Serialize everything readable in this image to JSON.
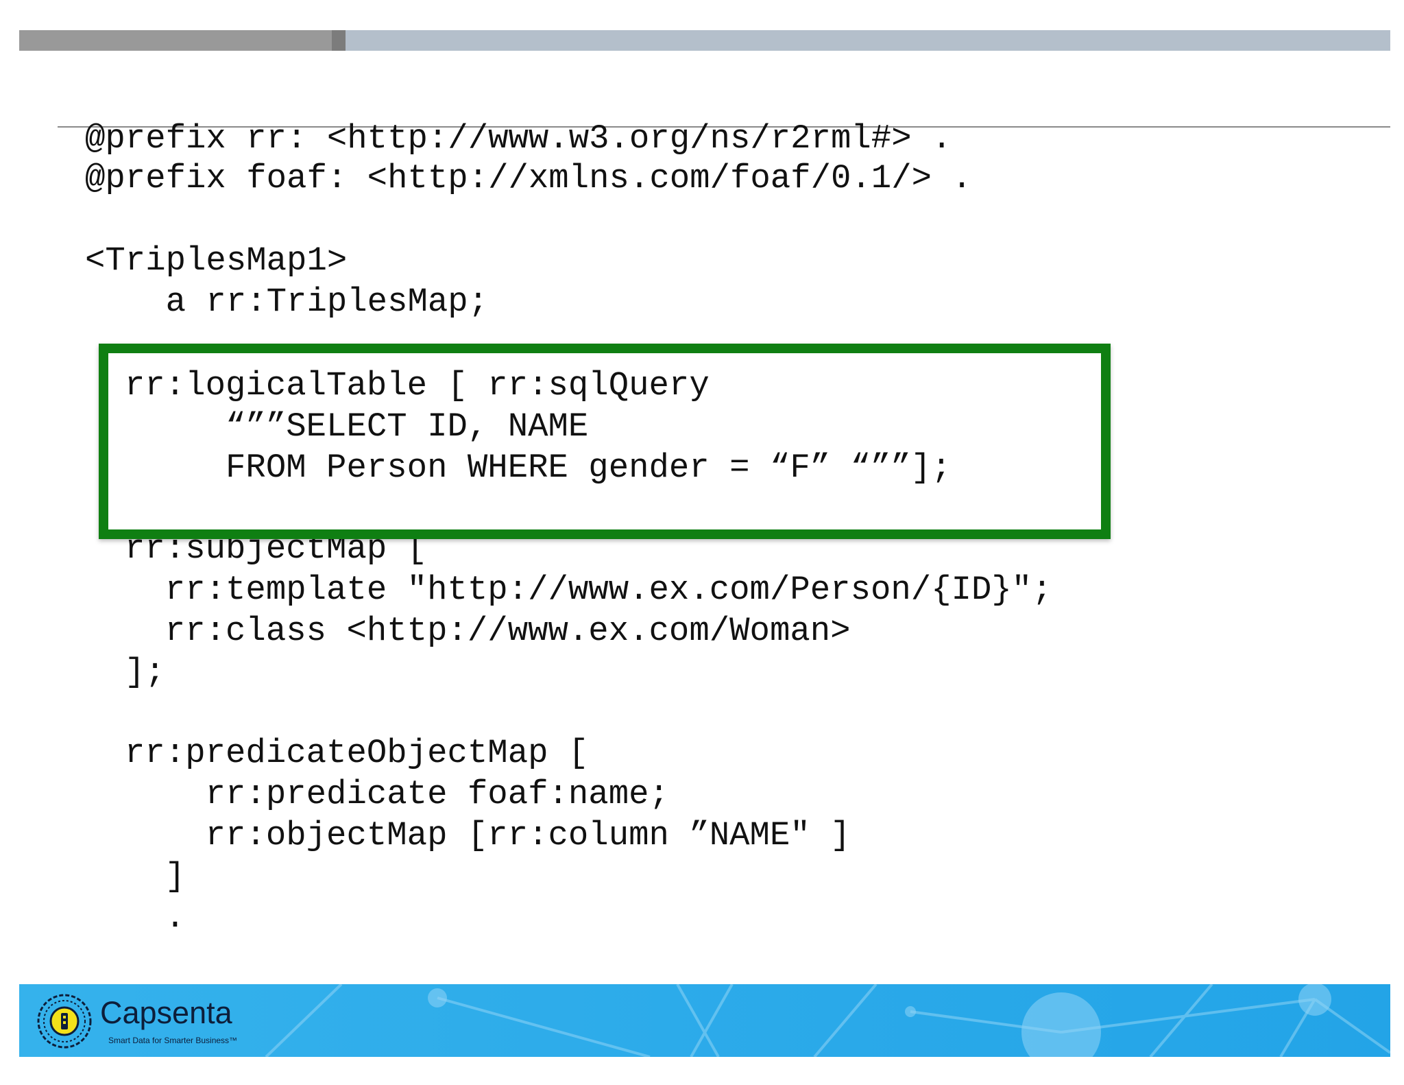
{
  "code": {
    "lines": [
      "@prefix rr: <http://www.w3.org/ns/r2rml#> .",
      "@prefix foaf: <http://xmlns.com/foaf/0.1/> .",
      "<TriplesMap1>",
      "    a rr:TriplesMap;",
      "rr:logicalTable [ rr:sqlQuery",
      "     “””SELECT ID, NAME",
      "     FROM Person WHERE gender = “F” “””];",
      "rr:subjectMap [",
      "  rr:template \"http://www.ex.com/Person/{ID}\";",
      "  rr:class <http://www.ex.com/Woman>",
      "];",
      "rr:predicateObjectMap [",
      "    rr:predicate foaf:name;",
      "    rr:objectMap [rr:column ”NAME\" ]",
      "  ]",
      "  ."
    ]
  },
  "highlight": {
    "color": "#0f7f12"
  },
  "footer": {
    "brand_name": "Capsenta",
    "tagline": "Smart Data for Smarter Business™",
    "logo_icon": "capsenta-logo-icon",
    "background_color": "#2aa9e9"
  }
}
